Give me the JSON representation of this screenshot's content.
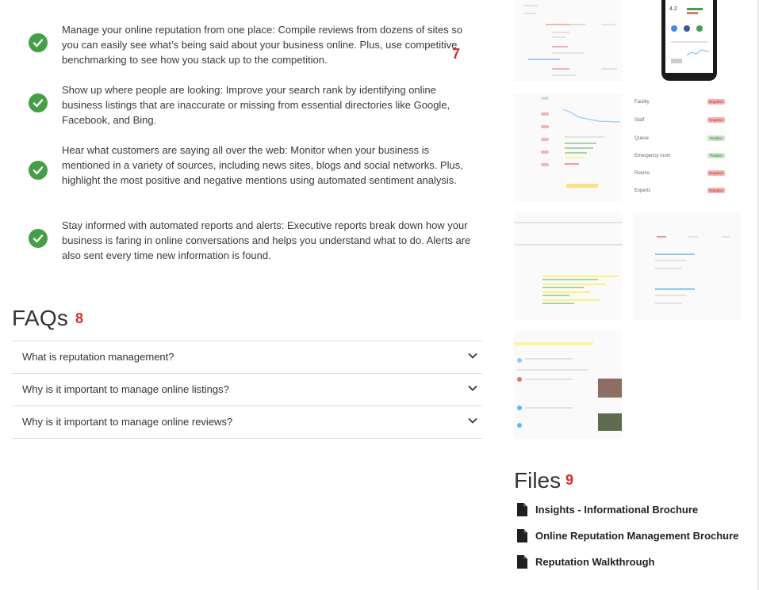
{
  "features": [
    {
      "icon": "check-circle-icon",
      "text": "Manage your online reputation from one place: Compile reviews from dozens of sites so you can easily see what’s being said about your business online. Plus, use competitive benchmarking to see how you stack up to the competition."
    },
    {
      "icon": "check-circle-icon",
      "text": "Show up where people are looking: Improve your search rank by identifying online business listings that are inaccurate or missing from essential directories like Google, Facebook, and Bing."
    },
    {
      "icon": "check-circle-icon",
      "text": "Hear what customers are saying all over the web: Monitor when your business is mentioned in a variety of sources, including news sites, blogs and social networks. Plus, highlight the most positive and negative mentions using automated sentiment analysis."
    },
    {
      "icon": "check-circle-icon",
      "text": "Stay informed with automated reports and alerts: Executive reports break down how your business is faring in online conversations and helps you understand what to do. Alerts are also sent every time new information is found."
    }
  ],
  "markers": {
    "features": "7",
    "faqs": "8",
    "files": "9"
  },
  "faqs": {
    "title": "FAQs",
    "items": [
      {
        "question": "What is reputation management?"
      },
      {
        "question": "Why is it important to manage online listings?"
      },
      {
        "question": "Why is it important to manage online reviews?"
      }
    ]
  },
  "thumbnails": {
    "sentiment_rows": [
      {
        "label": "Facility",
        "tag": "Negative"
      },
      {
        "label": "Staff",
        "tag": "Negative"
      },
      {
        "label": "Queue",
        "tag": "Positive"
      },
      {
        "label": "Emergency room",
        "tag": "Positive"
      },
      {
        "label": "Rooms",
        "tag": "Negative"
      },
      {
        "label": "Experts",
        "tag": "Negative"
      }
    ],
    "phone_rating": "4.2"
  },
  "files": {
    "title": "Files",
    "items": [
      {
        "label": "Insights - Informational Brochure",
        "icon": "document-icon"
      },
      {
        "label": "Online Reputation Management Brochure",
        "icon": "document-icon"
      },
      {
        "label": "Reputation Walkthrough",
        "icon": "document-icon"
      }
    ]
  },
  "colors": {
    "check": "#43a047",
    "marker": "#d32f2f",
    "divider": "#dcdcdc"
  }
}
